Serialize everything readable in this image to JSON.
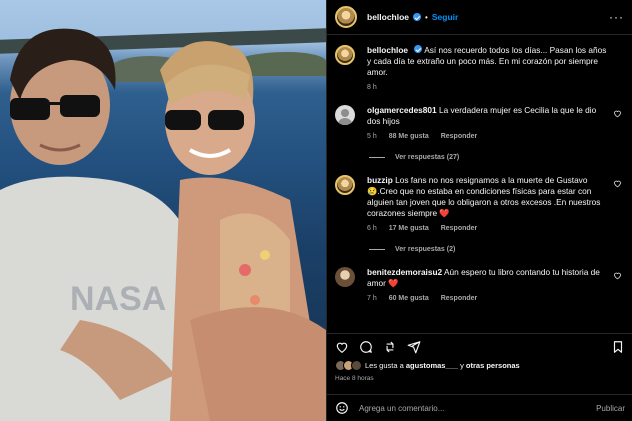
{
  "header": {
    "username": "bellochloe",
    "dot": "•",
    "follow_label": "Seguir",
    "more": "···"
  },
  "caption": {
    "username": "bellochloe",
    "text": "Así nos recuerdo todos los días... Pasan los años y cada día te extraño un poco más. En mi corazón por siempre amor.",
    "time": "8 h"
  },
  "comments": [
    {
      "username": "olgamercedes801",
      "text": "La verdadera mujer es Cecilia la que le dio dos hijos",
      "time": "5 h",
      "likes": "88 Me gusta",
      "reply": "Responder",
      "replies": "Ver respuestas (27)"
    },
    {
      "username": "buzzip",
      "text": "Los fans no nos resignamos a la muerte de Gustavo 😢.Creo que no estaba en condiciones físicas para estar con alguien tan joven que lo obligaron a otros excesos .En nuestros corazones siempre ❤️",
      "time": "6 h",
      "likes": "17 Me gusta",
      "reply": "Responder",
      "replies": "Ver respuestas (2)"
    },
    {
      "username": "benitezdemoraisu2",
      "text": "Aún espero tu libro contando tu historia de amor ❤️",
      "time": "7 h",
      "likes": "60 Me gusta",
      "reply": "Responder"
    }
  ],
  "likes_line": {
    "prefix": "Les gusta a",
    "user": "agustomas___",
    "connector": "y",
    "others": "otras personas"
  },
  "posted": "Hace 8 horas",
  "composer": {
    "placeholder": "Agrega un comentario...",
    "publish": "Publicar"
  },
  "colors": {
    "accent": "#0095f6",
    "verified": "#3897f0",
    "secondary_text": "#a8a8a8",
    "heart_red": "#ed4956"
  },
  "icons": [
    "heart-icon",
    "comment-icon",
    "share-icon",
    "bookmark-icon",
    "emoji-icon",
    "more-icon",
    "verified-icon"
  ]
}
